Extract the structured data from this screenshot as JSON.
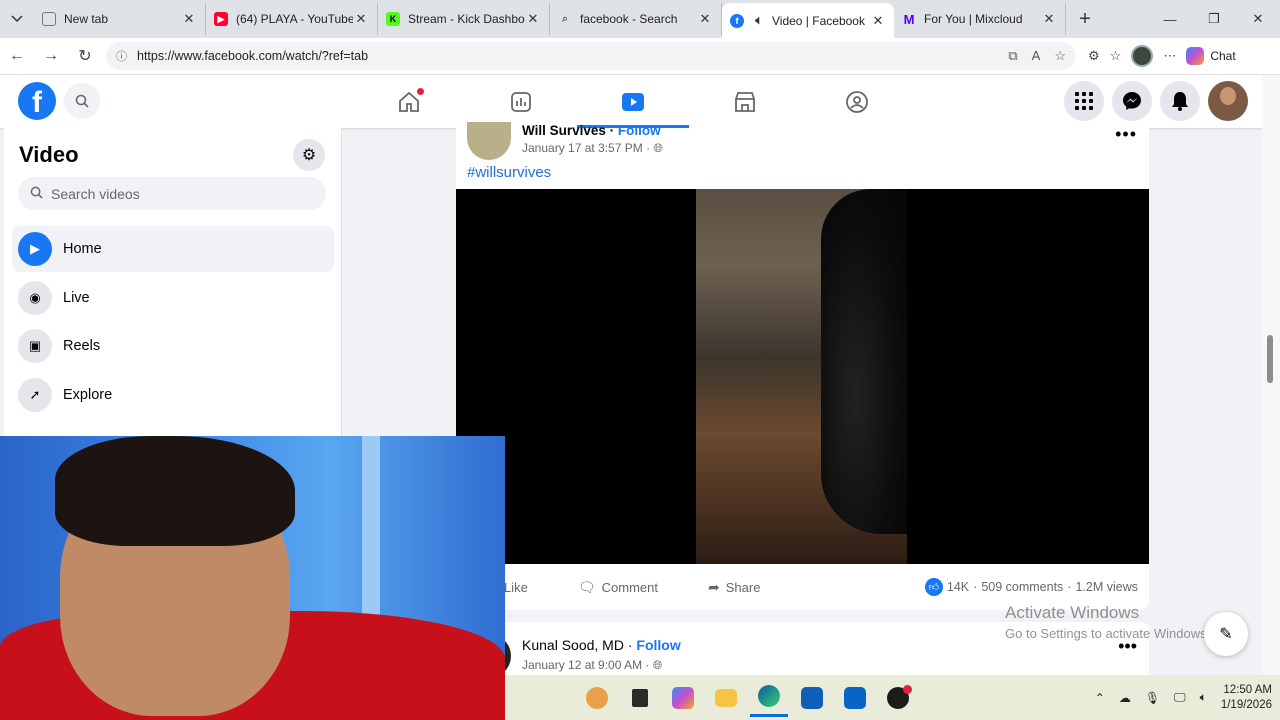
{
  "browser": {
    "tabs": [
      {
        "title": "New tab",
        "icon": "newtab-icon",
        "color": "#7a7a7a"
      },
      {
        "title": "(64) PLAYA - YouTube",
        "icon": "youtube-icon",
        "color": "#ff0033"
      },
      {
        "title": "Stream - Kick Dashboard",
        "icon": "kick-icon",
        "color": "#53fc18"
      },
      {
        "title": "facebook - Search",
        "icon": "search-icon",
        "color": "#8a8a8a"
      },
      {
        "title": "Video | Facebook",
        "icon": "facebook-icon",
        "color": "#1877f2",
        "active": true
      },
      {
        "title": "For You | Mixcloud",
        "icon": "mixcloud-icon",
        "color": "#5000ff"
      }
    ],
    "url": "https://www.facebook.com/watch/?ref=tab",
    "chat_label": "Chat"
  },
  "fb": {
    "logo": "f",
    "nav": [
      "home-icon",
      "dashboard-icon",
      "watch-icon",
      "marketplace-icon",
      "groups-icon"
    ],
    "active_nav": "watch-icon",
    "accent": "#1877f2"
  },
  "sidebar": {
    "title": "Video",
    "search_placeholder": "Search videos",
    "items": [
      {
        "label": "Home",
        "icon": "play-icon",
        "active": true
      },
      {
        "label": "Live",
        "icon": "live-icon"
      },
      {
        "label": "Reels",
        "icon": "reels-icon"
      },
      {
        "label": "Explore",
        "icon": "rocket-icon"
      }
    ]
  },
  "post1": {
    "author": "Will Survives",
    "separator": " · ",
    "follow": "Follow",
    "date": "January 17 at 3:57 PM",
    "date_suffix": " · ",
    "hashtag": "#willsurvives",
    "actions": {
      "like": "Like",
      "comment": "Comment",
      "share": "Share"
    },
    "reactions": "14K",
    "comments": "509 comments",
    "views": "1.2M views",
    "dot": "·"
  },
  "post2": {
    "author": "Kunal Sood, MD",
    "separator": " · ",
    "follow": "Follow",
    "date": "January 12 at 9:00 AM",
    "date_suffix": " · "
  },
  "watermark": {
    "line1": "Activate Windows",
    "line2": "Go to Settings to activate Windows."
  },
  "taskbar": {
    "time": "12:50 AM",
    "date": "1/19/2026"
  }
}
